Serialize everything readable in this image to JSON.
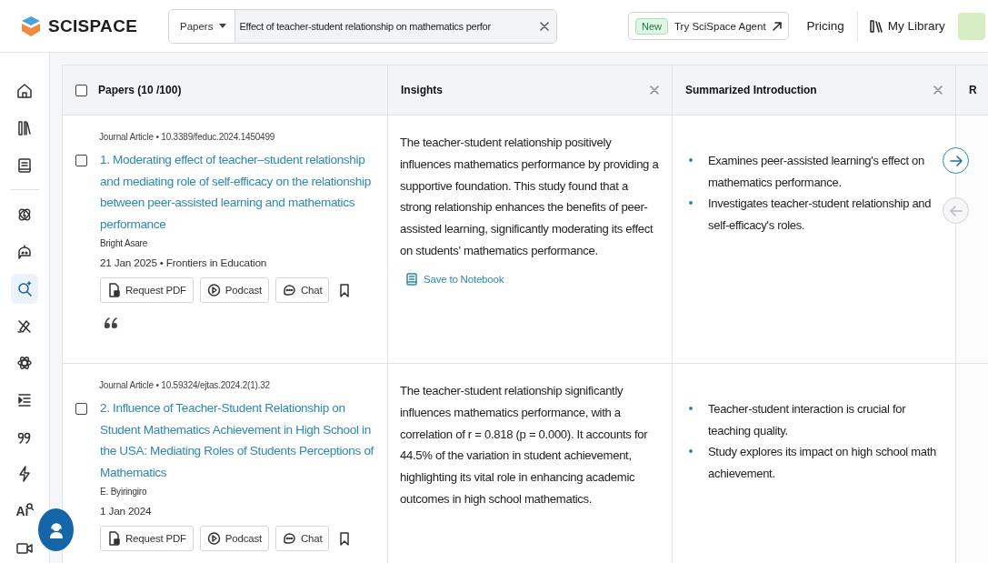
{
  "header": {
    "brand": "SCISPACE",
    "search": {
      "scope": "Papers",
      "value": "Effect of teacher-student relationship on mathematics perfor"
    },
    "agent_button": {
      "badge": "New",
      "label": "Try SciSpace Agent"
    },
    "pricing": "Pricing",
    "library": "My Library"
  },
  "sidebar": {
    "items": [
      {
        "kind": "home",
        "selected": false
      },
      {
        "kind": "books",
        "selected": false
      },
      {
        "kind": "notebook",
        "selected": false
      },
      {
        "kind": "divider"
      },
      {
        "kind": "orbit",
        "selected": false
      },
      {
        "kind": "bot",
        "selected": false
      },
      {
        "kind": "search",
        "selected": true
      },
      {
        "kind": "pen",
        "selected": false
      },
      {
        "kind": "atom",
        "selected": false
      },
      {
        "kind": "list",
        "selected": false
      },
      {
        "kind": "quote",
        "selected": false
      },
      {
        "kind": "bolt",
        "selected": false
      },
      {
        "kind": "ai",
        "label": "Ai",
        "selected": false
      },
      {
        "kind": "video",
        "selected": false
      }
    ]
  },
  "table": {
    "header_checkbox": {
      "checked": false
    },
    "columns": [
      {
        "title": "Papers (10 /100)",
        "closable": false
      },
      {
        "title": "Insights",
        "closable": true
      },
      {
        "title": "Summarized Introduction",
        "closable": true
      },
      {
        "title": "R"
      }
    ],
    "rows": [
      {
        "checked": false,
        "type": "Journal Article",
        "separator": "•",
        "doi": "10.3389/feduc.2024.1450499",
        "title": "1. Moderating effect of teacher–student relationship and mediating role of self-efficacy on the relationship between peer-assisted learning and mathematics performance",
        "authors": "Bright Asare",
        "date": "21 Jan 2025",
        "date_separator": "•",
        "venue": "Frontiers in Education",
        "actions": [
          "Request PDF",
          "Podcast",
          "Chat"
        ],
        "cite": true,
        "insight": "The teacher-student relationship positively influences mathematics performance by providing a supportive foundation. This study found that a strong relationship enhances the benefits of peer-assisted learning, significantly moderating its effect on students' mathematics performance.",
        "save_label": "Save to Notebook",
        "summary": [
          "Examines peer-assisted learning's effect on mathematics performance.",
          "Investigates teacher-student relationship and self-efficacy's roles."
        ]
      },
      {
        "checked": false,
        "type": "Journal Article",
        "separator": "•",
        "doi": "10.59324/ejtas.2024.2(1).32",
        "title": "2. Influence of Teacher-Student Relationship on Student Mathematics Achievement in High School in the USA: Mediating Roles of Students Perceptions of Mathematics",
        "authors": "E. Byiringiro",
        "date": "1 Jan 2024",
        "actions": [
          "Request PDF",
          "Podcast",
          "Chat"
        ],
        "insight": "The teacher-student relationship significantly influences mathematics performance, with a correlation of r = 0.818 (p = 0.000). It accounts for 44.5% of the variation in student achievement, highlighting its vital role in enhancing academic outcomes in high school mathematics.",
        "summary": [
          "Teacher-student interaction is crucial for teaching quality.",
          "Study explores its impact on high school math achievement."
        ]
      }
    ]
  },
  "scroll_nav": {
    "next_enabled": true,
    "prev_enabled": false
  }
}
